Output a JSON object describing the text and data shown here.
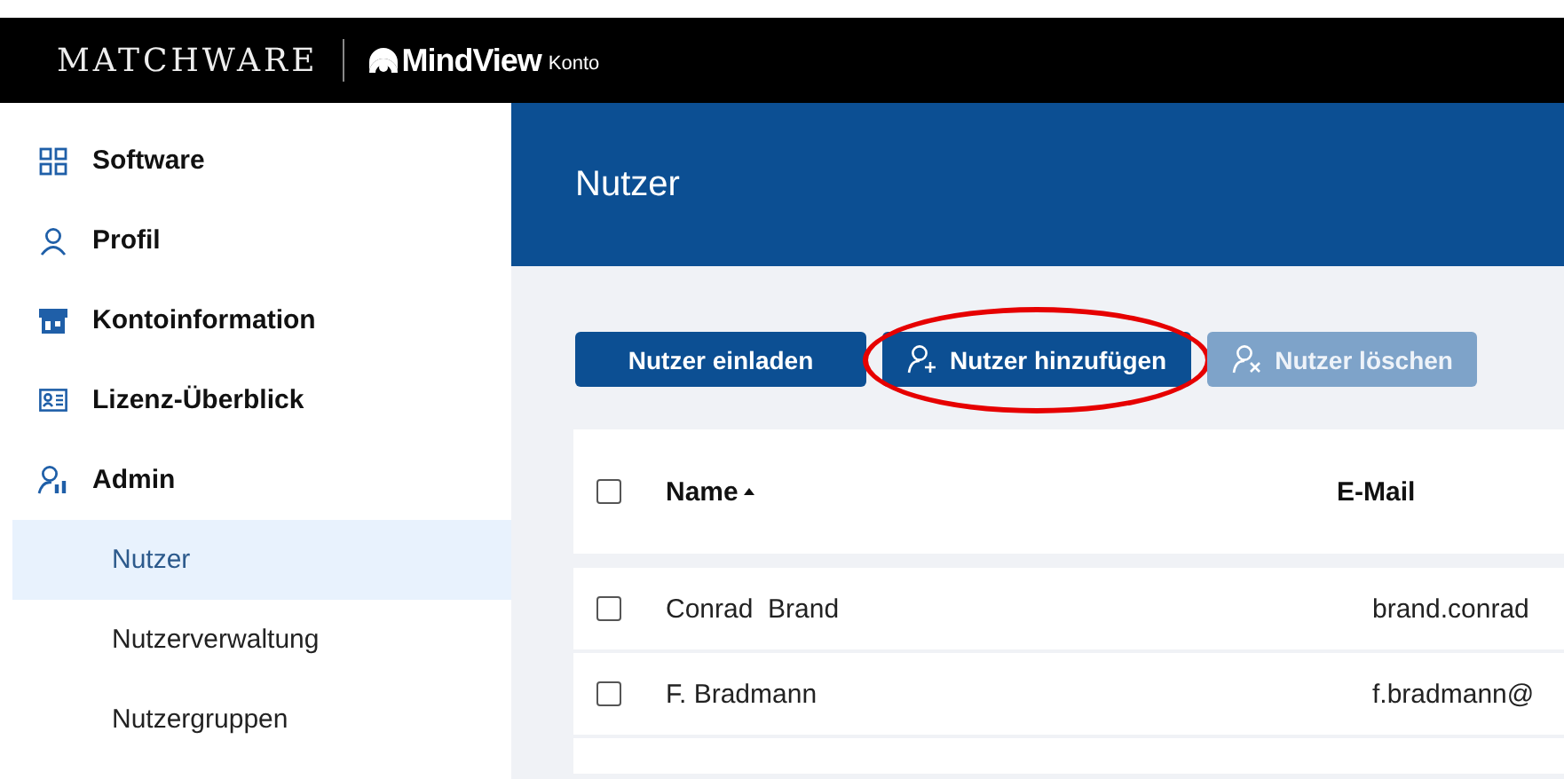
{
  "header": {
    "brand": "MATCHWARE",
    "product": "MindView",
    "product_suffix": "Konto"
  },
  "sidebar": {
    "items": [
      {
        "label": "Software",
        "selected": false
      },
      {
        "label": "Profil",
        "selected": false
      },
      {
        "label": "Kontoinformation",
        "selected": false
      },
      {
        "label": "Lizenz-Überblick",
        "selected": false
      },
      {
        "label": "Admin",
        "selected": false,
        "children": [
          {
            "label": "Nutzer",
            "selected": true
          },
          {
            "label": "Nutzerverwaltung",
            "selected": false
          },
          {
            "label": "Nutzergruppen",
            "selected": false
          }
        ]
      }
    ]
  },
  "page_title": "Nutzer",
  "buttons": [
    {
      "label": "Nutzer einladen",
      "disabled": false,
      "circled": false
    },
    {
      "label": "Nutzer hinzufügen",
      "disabled": false,
      "circled": true
    },
    {
      "label": "Nutzer löschen",
      "disabled": true,
      "circled": false
    }
  ],
  "table": {
    "columns": [
      {
        "label": "Name",
        "sorted": true
      },
      {
        "label": "E-Mail",
        "sorted": false
      }
    ],
    "header_checked": false,
    "rows": [
      {
        "name": "Conrad  Brand",
        "email": "brand.conrad",
        "checked": false
      },
      {
        "name": "F. Bradmann",
        "email": "f.bradmann@",
        "checked": false
      }
    ]
  }
}
